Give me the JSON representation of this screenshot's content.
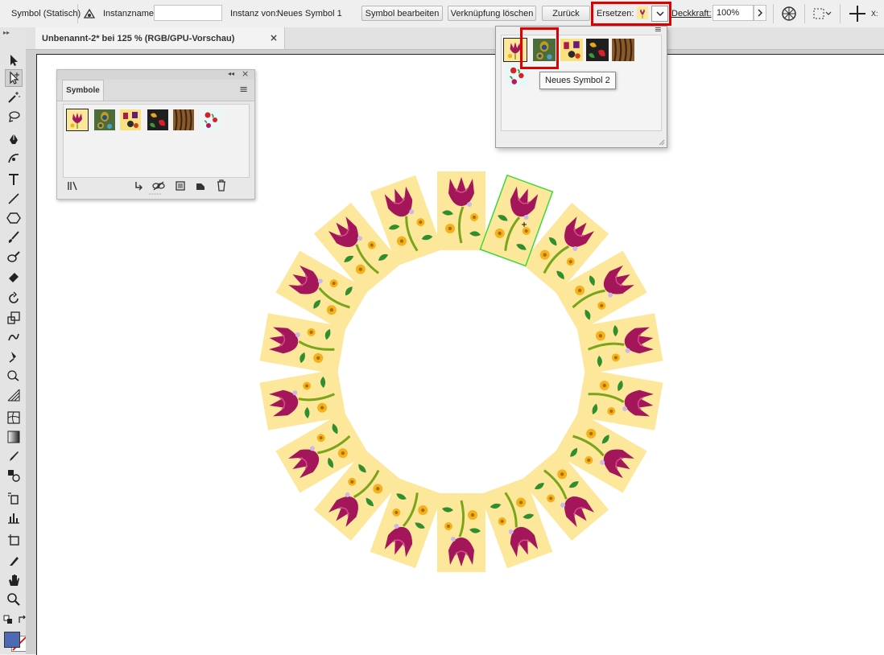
{
  "control_bar": {
    "object_type": "Symbol (Statisch)",
    "instance_name_label": "Instanzname:",
    "instance_name_value": "",
    "instance_of_label": "Instanz von:",
    "instance_of_value": "Neues Symbol 1",
    "edit_symbol_button": "Symbol bearbeiten",
    "break_link_button": "Verknüpfung löschen",
    "reset_button": "Zurück",
    "replace_label": "Ersetzen:",
    "opacity_label": "Deckkraft:",
    "opacity_value": "100%",
    "x_label": "X:"
  },
  "document_tab": {
    "title": "Unbenannt-2* bei 125 % (RGB/GPU-Vorschau)",
    "close": "×"
  },
  "symbols_panel": {
    "tab": "Symbole",
    "collapse": "◂◂",
    "close": "×",
    "menu": "≡"
  },
  "replace_dropdown": {
    "tooltip": "Neues Symbol 2",
    "menu": "≡"
  },
  "swatch_colors": {
    "sym1": "#fde79a",
    "sym2": "#4c6d3a",
    "sym3": "#f7e27f",
    "sym4": "#1f1f1f",
    "sym5": "#8a5a2b",
    "sym6": "#eaf7f7"
  },
  "highlight_color": "#e00000",
  "selection_color": "#3ad93a"
}
